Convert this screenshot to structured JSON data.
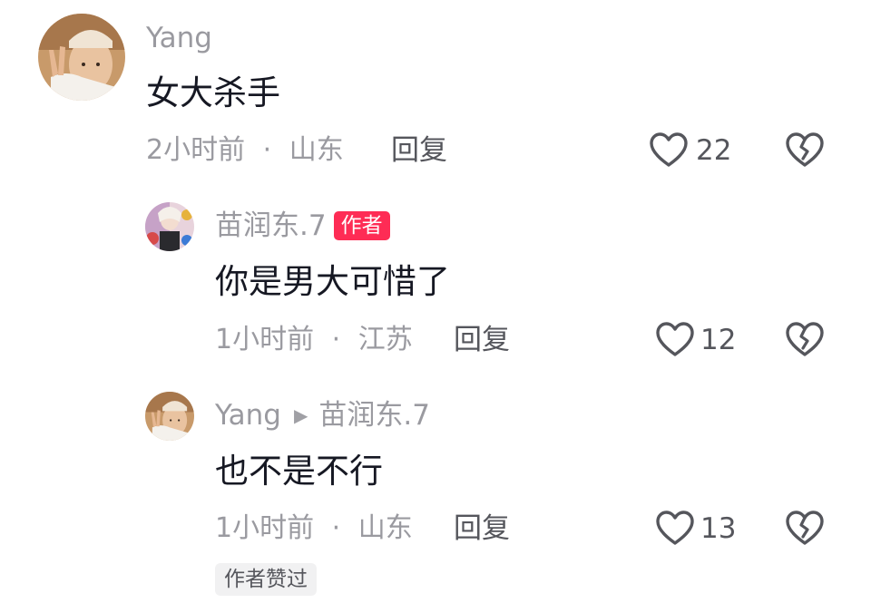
{
  "comments": [
    {
      "username": "Yang",
      "content": "女大杀手",
      "time": "2小时前",
      "location": "山东",
      "reply_label": "回复",
      "likes": "22"
    }
  ],
  "replies": [
    {
      "username": "苗润东.7",
      "author_badge": "作者",
      "content": "你是男大可惜了",
      "time": "1小时前",
      "location": "江苏",
      "reply_label": "回复",
      "likes": "12"
    },
    {
      "username": "Yang",
      "reply_to": "苗润东.7",
      "content": "也不是不行",
      "time": "1小时前",
      "location": "山东",
      "reply_label": "回复",
      "likes": "13",
      "liked_by_author_badge": "作者赞过"
    }
  ],
  "meta_separator": "·",
  "icons": {
    "like": "heart-outline-icon",
    "dislike": "broken-heart-icon",
    "reply_arrow": "triangle-right-icon"
  },
  "colors": {
    "author_badge_bg": "#fe2c55",
    "secondary_text": "#9a9aa0",
    "primary_text": "#161823"
  }
}
